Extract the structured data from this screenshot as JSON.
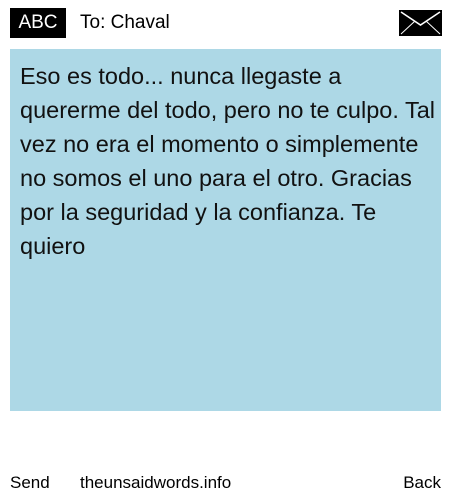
{
  "header": {
    "badge_label": "ABC",
    "recipient": "To: Chaval",
    "envelope_icon": "envelope-icon"
  },
  "message": {
    "body": "Eso es todo... nunca llegaste a quererme del todo, pero no te culpo. Tal vez no era el momento o simplemente no somos el uno para el otro. Gracias por la seguridad y la confianza. Te quiero"
  },
  "footer": {
    "send_label": "Send",
    "site_label": "theunsaidwords.info",
    "back_label": "Back"
  },
  "colors": {
    "message_background": "#add8e6",
    "badge_background": "#000000",
    "page_background": "#ffffff"
  }
}
